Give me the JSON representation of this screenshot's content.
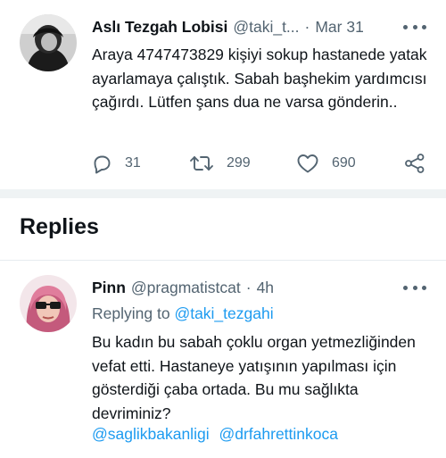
{
  "tweet": {
    "name": "Aslı Tezgah Lobisi",
    "handle": "@taki_t...",
    "separator": "·",
    "time": "Mar 31",
    "text": "Araya 4747473829 kişiyi sokup hastanede yatak ayarlamaya çalıştık. Sabah başhekim yardımcısı çağırdı. Lütfen şans dua ne varsa gönderin..",
    "reply_count": "31",
    "retweet_count": "299",
    "like_count": "690",
    "icons": [
      "more-icon",
      "reply-icon",
      "retweet-icon",
      "like-icon",
      "share-icon"
    ]
  },
  "section": {
    "title": "Replies"
  },
  "reply": {
    "name": "Pinn",
    "handle": "@pragmatistcat",
    "separator": "·",
    "time": "4h",
    "replying_prefix": "Replying to",
    "replying_to": "@taki_tezgahi",
    "text": "Bu kadın bu sabah çoklu organ yetmezliğinden vefat etti. Hastaneye yatışının yapılması için gösterdiği çaba ortada. Bu mu sağlıkta devriminiz?",
    "mentions": [
      "@saglikbakanligi",
      "@drfahrettinkoca"
    ]
  },
  "colors": {
    "text": "#0f1419",
    "secondary": "#536471",
    "link": "#1d9bf0",
    "divider": "#eff3f4"
  }
}
